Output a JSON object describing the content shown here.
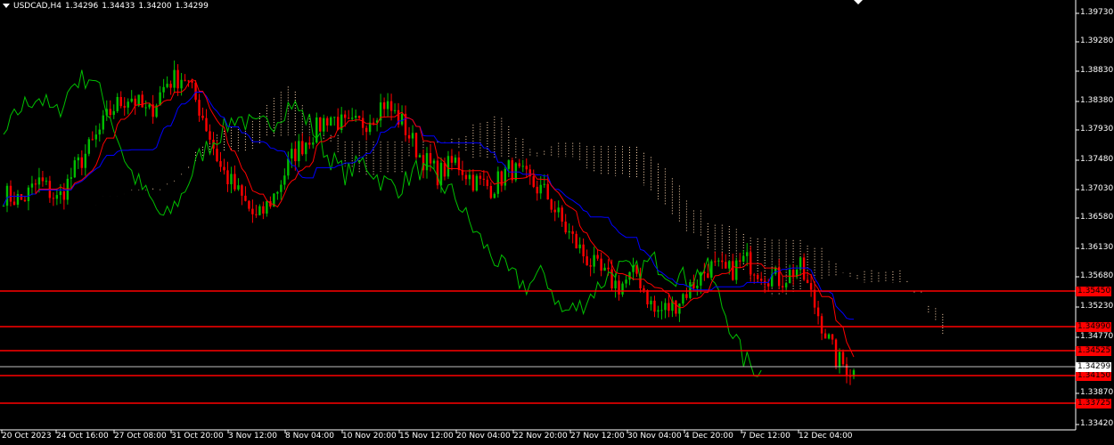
{
  "header": {
    "symbol": "USDCAD,H4",
    "open": "1.34296",
    "high": "1.34433",
    "low": "1.34200",
    "close": "1.34299"
  },
  "price_axis": [
    "1.39730",
    "1.39280",
    "1.38830",
    "1.38380",
    "1.37930",
    "1.37480",
    "1.37030",
    "1.36580",
    "1.36130",
    "1.35680",
    "1.35230",
    "1.34770",
    "1.33870",
    "1.33420"
  ],
  "levels": [
    {
      "label": "1.35450",
      "color": "#ff0000"
    },
    {
      "label": "1.34990",
      "color": "#ff0000"
    },
    {
      "label": "1.34525",
      "color": "#ff0000"
    },
    {
      "label": "1.34150",
      "color": "#ff0000"
    },
    {
      "label": "1.33725",
      "color": "#ff0000"
    }
  ],
  "current_price": {
    "label": "1.34299"
  },
  "time_axis": [
    "20 Oct 2023",
    "24 Oct 16:00",
    "27 Oct 08:00",
    "31 Oct 20:00",
    "3 Nov 12:00",
    "8 Nov 04:00",
    "10 Nov 20:00",
    "15 Nov 12:00",
    "20 Nov 04:00",
    "22 Nov 20:00",
    "27 Nov 12:00",
    "30 Nov 04:00",
    "4 Dec 20:00",
    "7 Dec 12:00",
    "12 Dec 04:00"
  ],
  "colors": {
    "background": "#000000",
    "bull_candle": "#00c000",
    "bear_candle": "#ff0000",
    "tenkan": "#ff0000",
    "kijun": "#0000ff",
    "chikou": "#00c000",
    "cloud": "#ffd8b0",
    "level_line": "#ff0000",
    "current_line": "#c0c0c0"
  },
  "chart_data": {
    "type": "candlestick",
    "symbol": "USDCAD",
    "timeframe": "H4",
    "indicator": "ichimoku",
    "ylim": [
      1.3342,
      1.3995
    ],
    "close_path": [
      1.37,
      1.369,
      1.372,
      1.369,
      1.374,
      1.378,
      1.383,
      1.385,
      1.382,
      1.387,
      1.388,
      1.382,
      1.374,
      1.37,
      1.366,
      1.37,
      1.376,
      1.379,
      1.382,
      1.38,
      1.381,
      1.384,
      1.381,
      1.376,
      1.373,
      1.375,
      1.372,
      1.371,
      1.374,
      1.372,
      1.37,
      1.365,
      1.361,
      1.358,
      1.356,
      1.358,
      1.352,
      1.353,
      1.356,
      1.359,
      1.358,
      1.36,
      1.358,
      1.357,
      1.359,
      1.352,
      1.345,
      1.3429
    ]
  }
}
